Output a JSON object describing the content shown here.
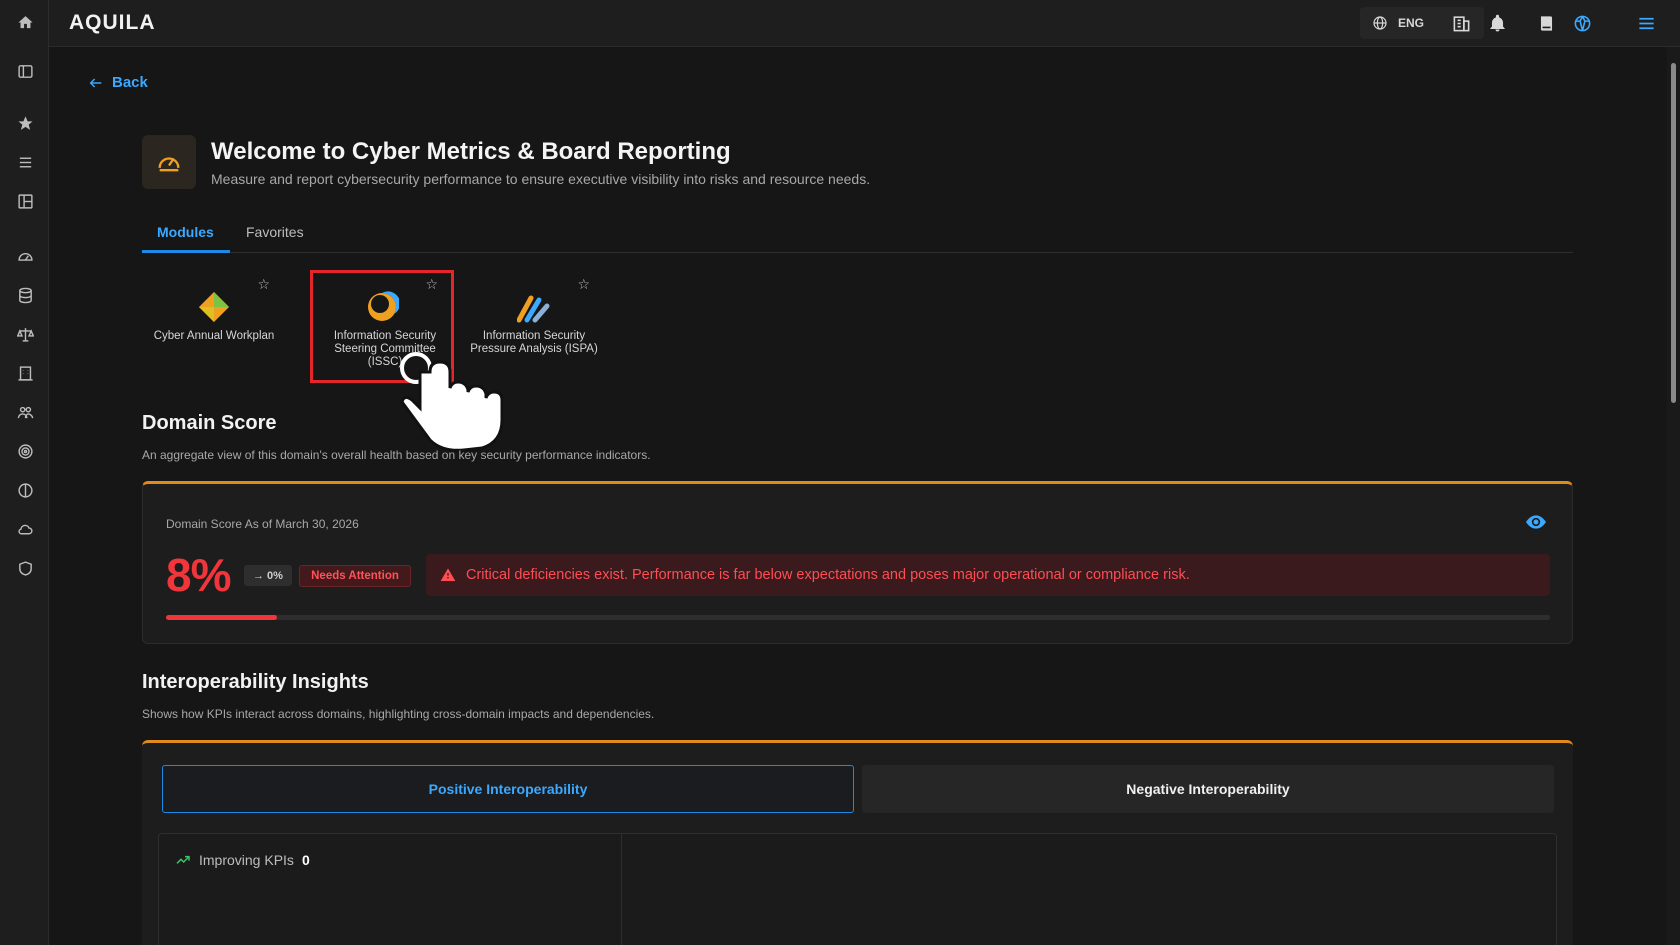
{
  "app": {
    "logo": "AQUILA"
  },
  "topbar": {
    "language": "ENG"
  },
  "nav": {
    "back_label": "Back"
  },
  "header": {
    "title": "Welcome to Cyber Metrics & Board Reporting",
    "subtitle": "Measure and report cybersecurity performance to ensure executive visibility into risks and resource needs."
  },
  "tabs": [
    {
      "label": "Modules",
      "active": true
    },
    {
      "label": "Favorites",
      "active": false
    }
  ],
  "modules": [
    {
      "label": "Cyber Annual Workplan",
      "selected": false
    },
    {
      "label": "Information Security Steering Committee (ISSC)",
      "selected": true
    },
    {
      "label": "Information Security Pressure Analysis (ISPA)",
      "selected": false
    }
  ],
  "domain_score": {
    "title": "Domain Score",
    "description": "An aggregate view of this domain's overall health based on key security performance indicators.",
    "as_of": "Domain Score As of March 30, 2026",
    "value": "8%",
    "percent": 8,
    "trend": "0%",
    "status": "Needs Attention",
    "alert": "Critical deficiencies exist. Performance is far below expectations and poses major operational or compliance risk.",
    "colors": {
      "critical": "#f0353b",
      "accent": "#e08a1e"
    }
  },
  "interoperability": {
    "title": "Interoperability Insights",
    "description": "Shows how KPIs interact across domains, highlighting cross-domain impacts and dependencies.",
    "tabs": [
      {
        "label": "Positive Interoperability",
        "active": true
      },
      {
        "label": "Negative Interoperability",
        "active": false
      }
    ],
    "improving_label": "Improving KPIs",
    "improving_count": "0"
  },
  "icons": {
    "rail": [
      "home-icon",
      "sidebar-toggle-icon",
      "star-icon",
      "menu-icon",
      "layout-icon",
      "gauge-icon",
      "database-icon",
      "scale-icon",
      "building-icon",
      "users-icon",
      "target-icon",
      "compass-icon",
      "cloud-icon",
      "shield-icon"
    ],
    "topbar": [
      "globe-icon",
      "building-icon",
      "bell-icon",
      "book-icon",
      "settings-globe-icon",
      "hamburger-icon"
    ]
  },
  "colors": {
    "brand_blue": "#1e88e5"
  }
}
